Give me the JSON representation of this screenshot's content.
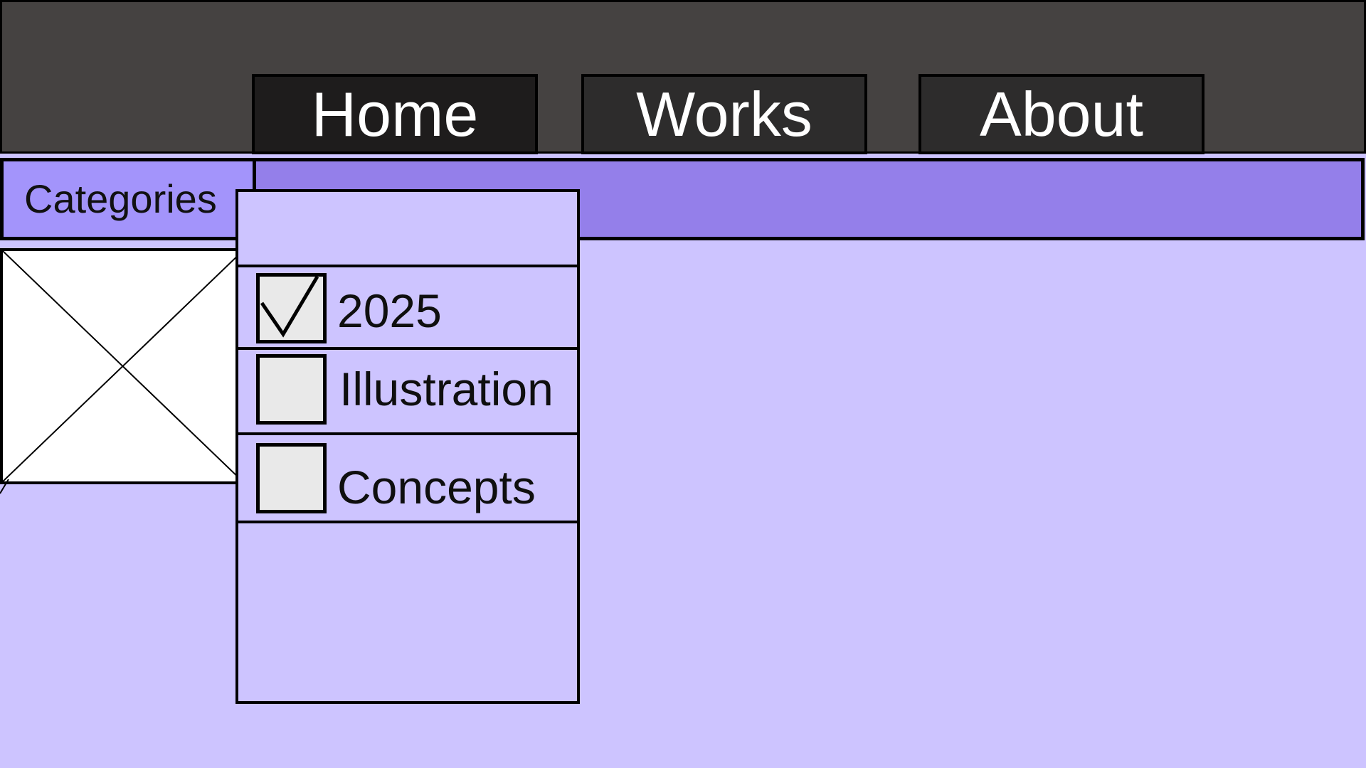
{
  "nav": {
    "tabs": [
      {
        "label": "Home"
      },
      {
        "label": "Works"
      },
      {
        "label": "About"
      }
    ]
  },
  "filter": {
    "button_label": "Categories",
    "options": [
      {
        "label": "2025",
        "checked": true
      },
      {
        "label": "Illustration",
        "checked": false
      },
      {
        "label": "Concepts",
        "checked": false
      }
    ]
  },
  "colors": {
    "header_bg": "#454241",
    "tab_active_bg": "#1e1c1c",
    "tab_bg": "#2d2c2c",
    "category_bar": "#947fea",
    "category_button": "#a394fb",
    "page_bg": "#cdc4ff",
    "checkbox_bg": "#e9e9e9"
  },
  "icons": {
    "image": "image-placeholder-icon",
    "check": "checkmark-icon"
  }
}
